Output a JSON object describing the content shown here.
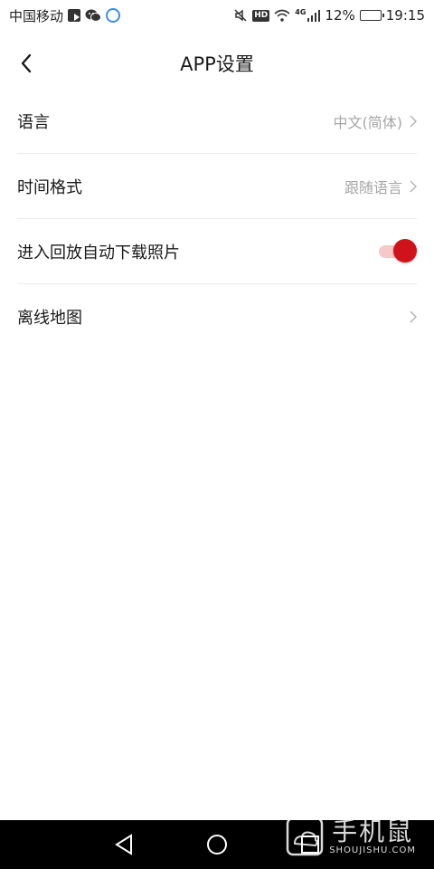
{
  "status_bar": {
    "carrier": "中国移动",
    "network": "4G",
    "hd": "HD",
    "battery_percent": "12%",
    "time": "19:15"
  },
  "header": {
    "title": "APP设置"
  },
  "settings": {
    "items": [
      {
        "label": "语言",
        "value": "中文(简体)",
        "type": "select"
      },
      {
        "label": "时间格式",
        "value": "跟随语言",
        "type": "select"
      },
      {
        "label": "进入回放自动下载照片",
        "type": "toggle",
        "toggle_on": true
      },
      {
        "label": "离线地图",
        "value": "",
        "type": "link"
      }
    ]
  },
  "colors": {
    "accent": "#d0121b",
    "toggle_track": "#f6c8c8",
    "secondary_text": "#a6a6a6",
    "divider": "#ececec"
  },
  "watermark": {
    "big": "手机鼠",
    "small": "SHOUJISHU.COM"
  }
}
